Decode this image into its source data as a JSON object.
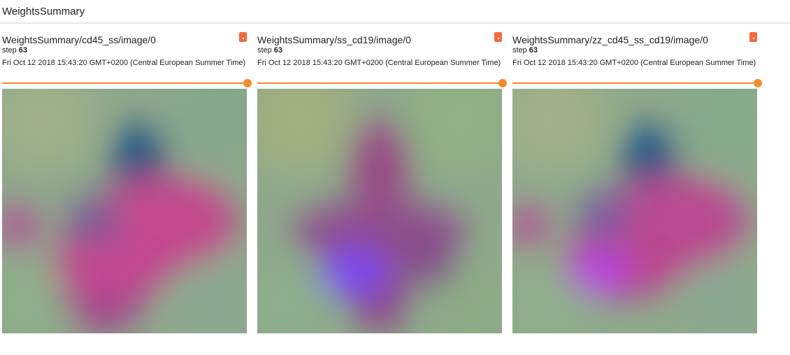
{
  "header": {
    "title": "WeightsSummary"
  },
  "cards": [
    {
      "title": "WeightsSummary/cd45_ss/image/0",
      "step_label": "step",
      "step_value": "63",
      "timestamp": "Fri Oct 12 2018 15:43:20 GMT+0200 (Central European Summer Time)"
    },
    {
      "title": "WeightsSummary/ss_cd19/image/0",
      "step_label": "step",
      "step_value": "63",
      "timestamp": "Fri Oct 12 2018 15:43:20 GMT+0200 (Central European Summer Time)"
    },
    {
      "title": "WeightsSummary/zz_cd45_ss_cd19/image/0",
      "step_label": "step",
      "step_value": "63",
      "timestamp": "Fri Oct 12 2018 15:43:20 GMT+0200 (Central European Summer Time)"
    }
  ],
  "colors": {
    "accent": "#f28c2e",
    "expand_button": "#f06a3d"
  }
}
